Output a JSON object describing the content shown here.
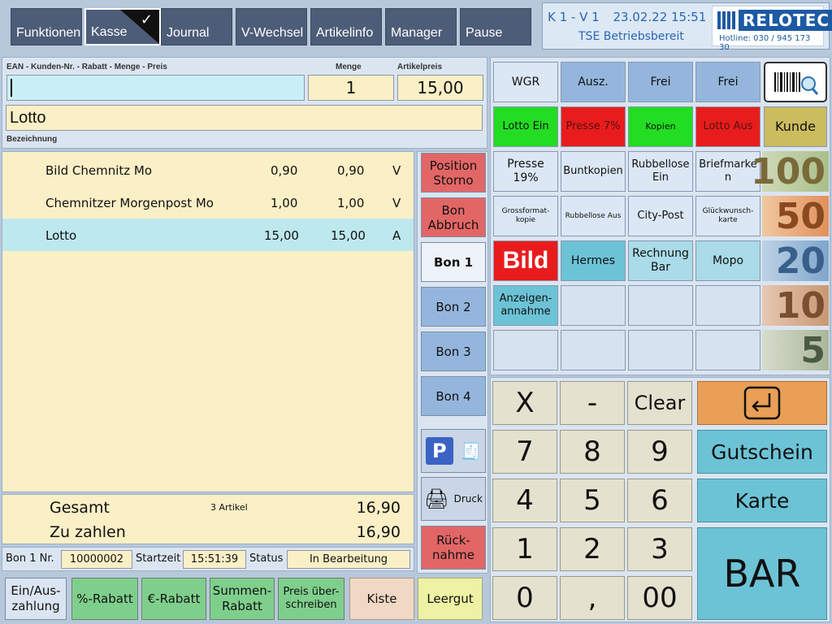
{
  "menu": {
    "items": [
      {
        "label": "Funktionen"
      },
      {
        "label": "Kasse"
      },
      {
        "label": "Journal"
      },
      {
        "label": "V-Wechsel"
      },
      {
        "label": "Artikelinfo"
      },
      {
        "label": "Manager"
      },
      {
        "label": "Pause"
      }
    ]
  },
  "info": {
    "terminal": "K 1 - V 1",
    "datetime": "23.02.22 15:51",
    "tse": "TSE Betriebsbereit",
    "logo": "RELOTEC",
    "hotline": "Hotline: 030 / 945 173 30"
  },
  "entry": {
    "ean_label": "EAN - Kunden-Nr. - Rabatt - Menge - Preis",
    "menge_label": "Menge",
    "preis_label": "Artikelpreis",
    "ean_value": "",
    "menge_value": "1",
    "preis_value": "15,00",
    "bezeichnung_value": "Lotto",
    "bezeichnung_label": "Bezeichnung"
  },
  "items": [
    {
      "name": "Bild Chemnitz Mo",
      "price": "0,90",
      "total": "0,90",
      "tax": "V"
    },
    {
      "name": "Chemnitzer Morgenpost Mo",
      "price": "1,00",
      "total": "1,00",
      "tax": "V"
    },
    {
      "name": "Lotto",
      "price": "15,00",
      "total": "15,00",
      "tax": "A"
    }
  ],
  "totals": {
    "gesamt_label": "Gesamt",
    "count": "3 Artikel",
    "gesamt_value": "16,90",
    "zuzahlen_label": "Zu zahlen",
    "zuzahlen_value": "16,90"
  },
  "status": {
    "bon_label": "Bon 1 Nr.",
    "bon_nr": "10000002",
    "start_label": "Startzeit",
    "start_value": "15:51:39",
    "status_label": "Status",
    "status_value": "In Bearbeitung"
  },
  "mid": {
    "storno": "Position Storno",
    "abbruch": "Bon Abbruch",
    "bon1": "Bon 1",
    "bon2": "Bon 2",
    "bon3": "Bon 3",
    "bon4": "Bon 4",
    "parking": "P",
    "druck": "Druck",
    "rueck": "Rück-nahme"
  },
  "bottom": {
    "ein_aus": "Ein/Aus-zahlung",
    "prozent": "%-Rabatt",
    "euro": "€-Rabatt",
    "summen": "Summen-Rabatt",
    "preis": "Preis über-schreiben",
    "kiste": "Kiste",
    "leergut": "Leergut"
  },
  "grid": {
    "wgr": "WGR",
    "ausz": "Ausz.",
    "frei1": "Frei",
    "frei2": "Frei",
    "lotto_ein": "Lotto Ein",
    "presse7": "Presse 7%",
    "kopien": "Kopien",
    "lotto_aus": "Lotto Aus",
    "kunde": "Kunde",
    "presse19": "Presse 19%",
    "buntkopien": "Buntkopien",
    "rubbel_ein": "Rubbellose Ein",
    "briefmarke": "Briefmarke n",
    "gross": "Grossformat-kopie",
    "rubbel_aus": "Rubbellose Aus",
    "citypost": "City-Post",
    "glueck": "Glückwunsch-karte",
    "bild": "Bild",
    "hermes": "Hermes",
    "rechnung": "Rechnung Bar",
    "mopo": "Mopo",
    "anzeigen": "Anzeigen-annahme",
    "notes": [
      "100",
      "50",
      "20",
      "10",
      "5"
    ]
  },
  "numpad": {
    "x": "X",
    "minus": "-",
    "clear": "Clear",
    "k7": "7",
    "k8": "8",
    "k9": "9",
    "k4": "4",
    "k5": "5",
    "k6": "6",
    "k1": "1",
    "k2": "2",
    "k3": "3",
    "k0": "0",
    "comma": ",",
    "k00": "00",
    "gutschein": "Gutschein",
    "karte": "Karte",
    "bar": "BAR"
  },
  "colors": {
    "menu": "#4d5d78",
    "lotto_ein": "#22dd22",
    "red": "#e81c1c",
    "storno": "#e36666",
    "blue_btn": "#94b6dc",
    "teal_btn": "#6cc3d6",
    "green_btn": "#7fcf8c"
  }
}
